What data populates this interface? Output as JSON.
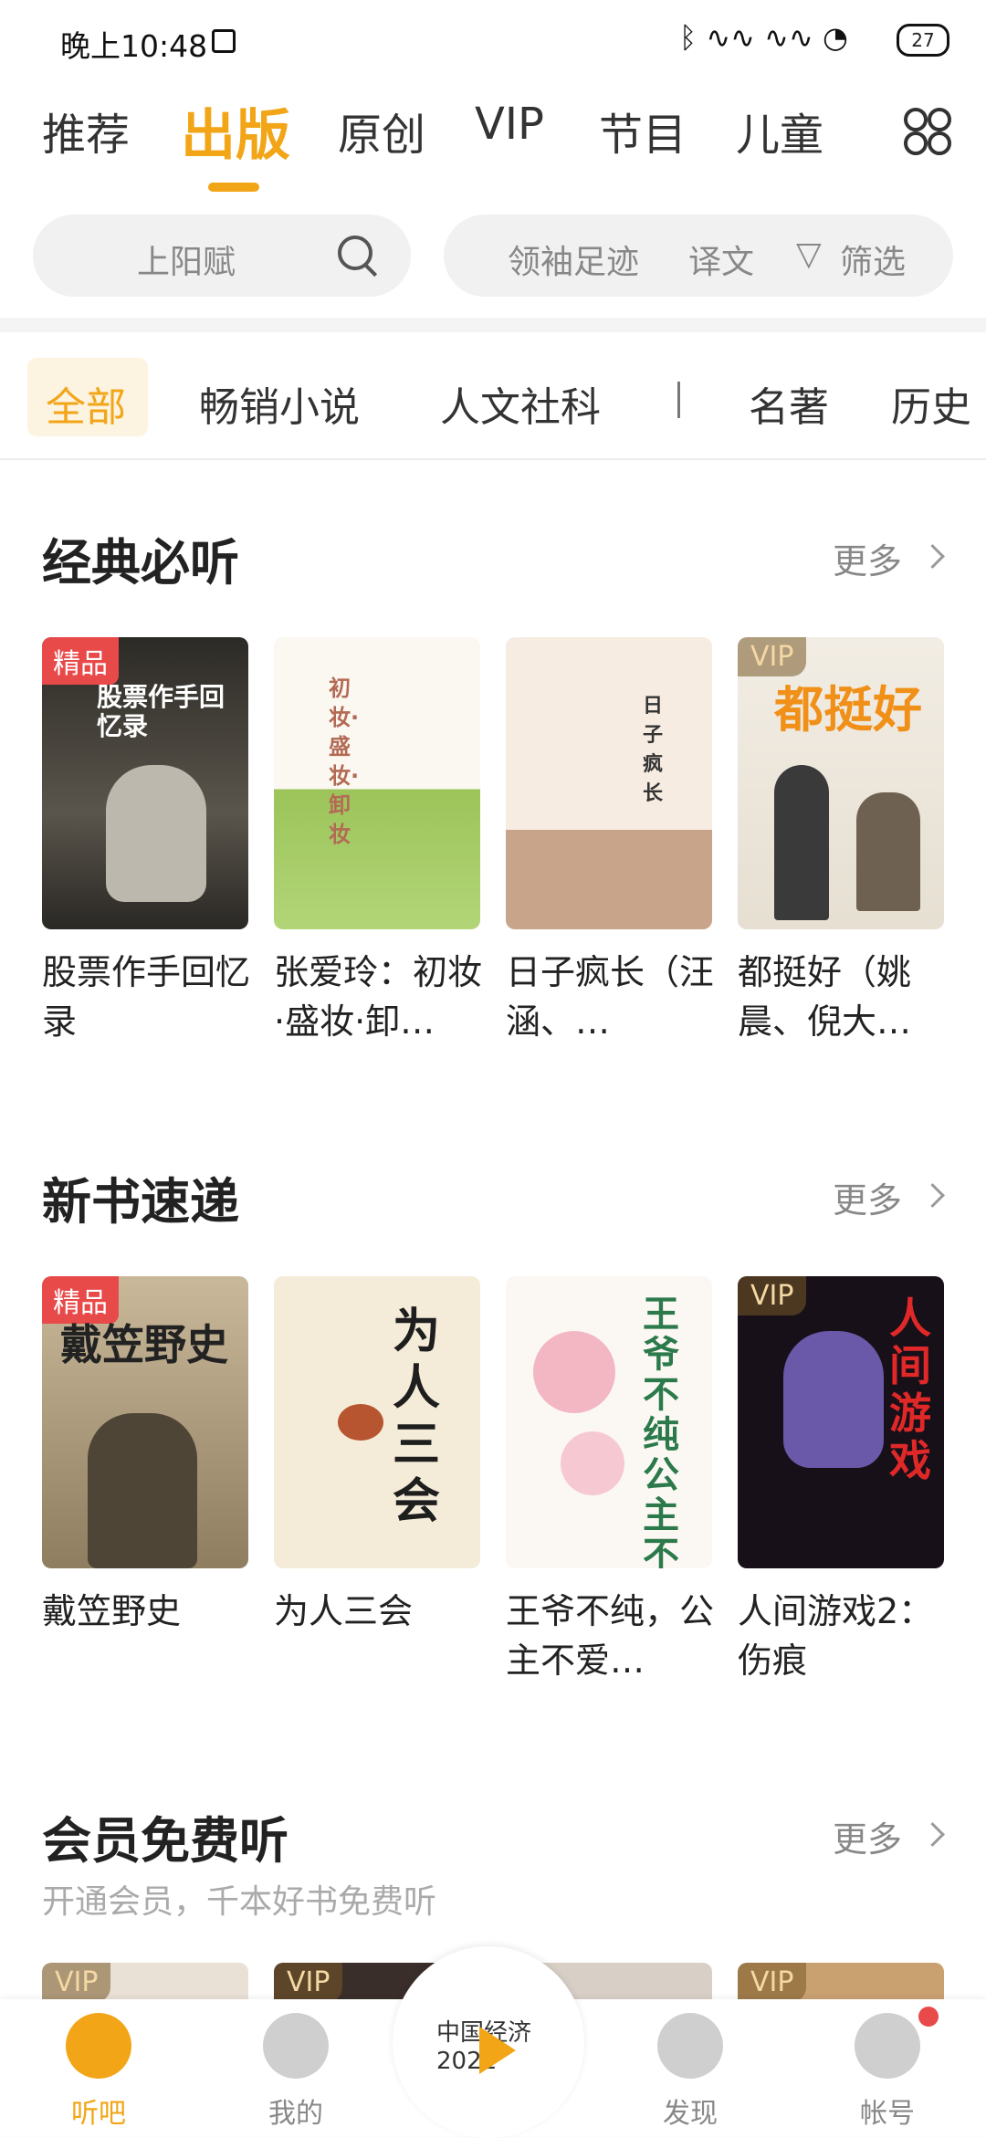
{
  "status_bar": {
    "time": "晚上10:48",
    "signal": "ᛒ ∿∿ ∿∿ ◔",
    "battery": "27"
  },
  "top_tabs": [
    "推荐",
    "出版",
    "原创",
    "VIP",
    "节目",
    "儿童"
  ],
  "search": {
    "placeholder": "上阳赋",
    "hints": [
      "领袖足迹",
      "译文"
    ],
    "filter": "筛选"
  },
  "categories": [
    "全部",
    "畅销小说",
    "人文社科",
    "名著",
    "历史"
  ],
  "sections": [
    {
      "title": "经典必听",
      "more": "更多",
      "books": [
        {
          "title": "股票作手回忆录",
          "badge": "精品",
          "cover_text": "股票作手回忆录"
        },
        {
          "title": "张爱玲：初妆·盛妆·卸…",
          "badge": "",
          "cover_text": "初妆·盛妆·卸妆"
        },
        {
          "title": "日子疯长（汪涵、…",
          "badge": "",
          "cover_text": "日子疯长"
        },
        {
          "title": "都挺好（姚晨、倪大…",
          "badge": "VIP",
          "cover_text": "都挺好"
        }
      ]
    },
    {
      "title": "新书速递",
      "more": "更多",
      "books": [
        {
          "title": "戴笠野史",
          "badge": "精品",
          "cover_text": "戴笠野史"
        },
        {
          "title": "为人三会",
          "badge": "",
          "cover_text": "为人三会"
        },
        {
          "title": "王爷不纯，公主不爱…",
          "badge": "",
          "cover_text": "王爷不纯公主不爱"
        },
        {
          "title": "人间游戏2：伤痕",
          "badge": "VIP",
          "cover_text": "人间游戏"
        }
      ]
    },
    {
      "title": "会员免费听",
      "more": "更多",
      "subtitle": "开通会员，千本好书免费听",
      "badges": [
        "VIP",
        "VIP",
        "VIP"
      ]
    }
  ],
  "bottom_nav": [
    "听吧",
    "我的",
    "发现",
    "帐号"
  ],
  "center_cover_text": "中国经济2021",
  "colors": {
    "accent": "#f2a516",
    "badge_red": "#e84a4a"
  }
}
